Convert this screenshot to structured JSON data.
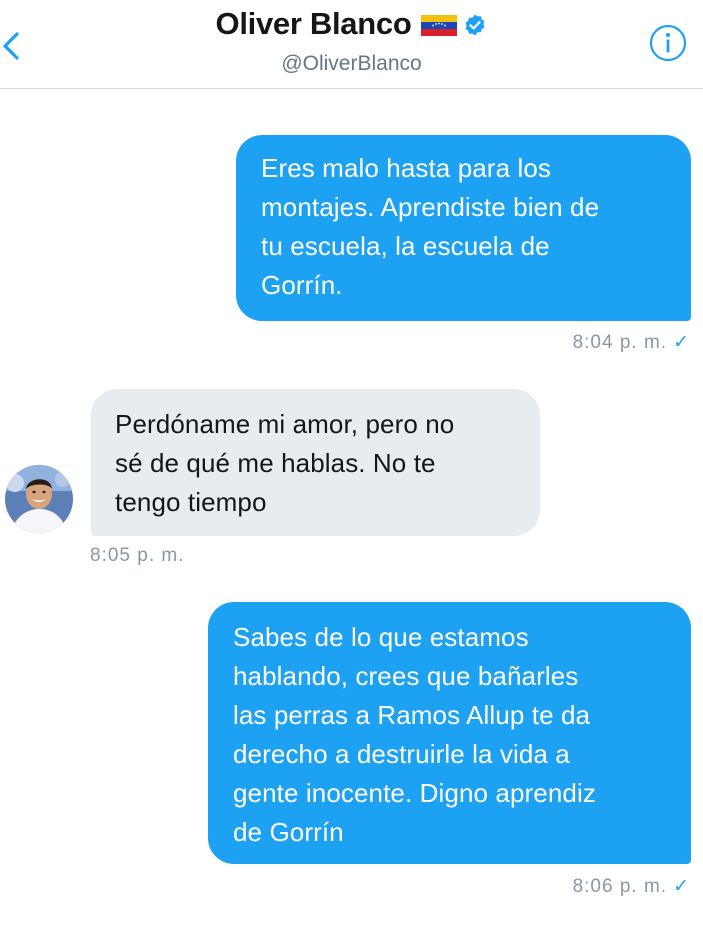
{
  "header": {
    "name": "Oliver Blanco",
    "handle": "@OliverBlanco",
    "back_icon": "chevron-left-icon",
    "info_icon": "info-circle-icon",
    "flag_icon": "venezuela-flag-icon",
    "verified_icon": "verified-badge-icon"
  },
  "colors": {
    "accent": "#1da1f2",
    "received_bubble": "#e6ecf0",
    "timestamp": "#8899a6",
    "divider": "#d9dde1"
  },
  "messages": [
    {
      "direction": "sent",
      "lines": [
        "Eres malo hasta para los",
        "montajes. Aprendiste bien de",
        "tu escuela, la escuela de",
        "Gorrín."
      ],
      "time": "8:04 p. m.",
      "read_mark": "✓"
    },
    {
      "direction": "received",
      "lines": [
        "Perdóname mi amor, pero no",
        "sé de qué me hablas. No te",
        "tengo tiempo"
      ],
      "time": "8:05 p. m."
    },
    {
      "direction": "sent",
      "lines": [
        "Sabes de lo que estamos",
        "hablando, crees que bañarles",
        "las perras a Ramos Allup te da",
        "derecho a destruirle la vida a",
        "gente inocente. Digno aprendiz",
        "de Gorrín"
      ],
      "time": "8:06 p. m.",
      "read_mark": "✓"
    }
  ]
}
